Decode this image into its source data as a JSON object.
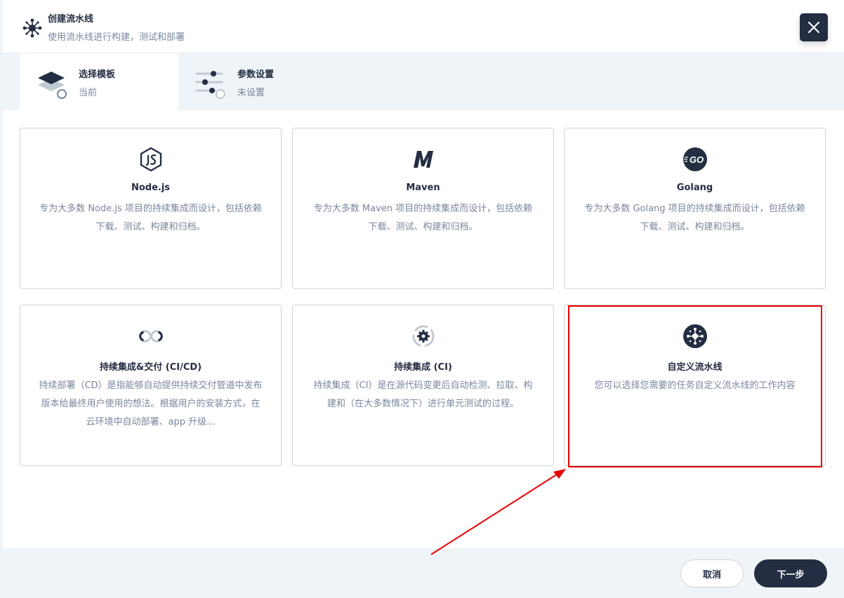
{
  "header": {
    "title": "创建流水线",
    "description": "使用流水线进行构建，测试和部署",
    "close_icon": "close-icon"
  },
  "steps": [
    {
      "title": "选择模板",
      "subtitle": "当前",
      "icon": "layers-icon",
      "active": true
    },
    {
      "title": "参数设置",
      "subtitle": "未设置",
      "icon": "sliders-icon",
      "active": false
    }
  ],
  "templates": [
    {
      "title": "Node.js",
      "description": "专为大多数 Node.js 项目的持续集成而设计，包括依赖下载、测试、构建和归档。",
      "icon": "nodejs-icon"
    },
    {
      "title": "Maven",
      "description": "专为大多数 Maven 项目的持续集成而设计，包括依赖下载、测试、构建和归档。",
      "icon": "maven-icon"
    },
    {
      "title": "Golang",
      "description": "专为大多数 Golang 项目的持续集成而设计，包括依赖下载、测试、构建和归档。",
      "icon": "golang-icon",
      "icon_text": "GO"
    },
    {
      "title": "持续集成&交付 (CI/CD)",
      "description": "持续部署（CD）是指能够自动提供持续交付管道中发布版本给最终用户使用的想法。根据用户的安装方式，在云环境中自动部署、app 升级...",
      "icon": "infinity-icon"
    },
    {
      "title": "持续集成 (CI)",
      "description": "持续集成（CI）是在源代码变更后自动检测、拉取、构建和（在大多数情况下）进行单元测试的过程。",
      "icon": "gear-icon"
    },
    {
      "title": "自定义流水线",
      "description": "您可以选择您需要的任务自定义流水线的工作内容",
      "icon": "pipeline-icon"
    }
  ],
  "footer": {
    "cancel_label": "取消",
    "next_label": "下一步"
  },
  "colors": {
    "primary": "#242e42",
    "muted": "#79879c",
    "border": "#ccd3db",
    "panel_bg": "#eff4f9",
    "annotation": "#e80000"
  }
}
